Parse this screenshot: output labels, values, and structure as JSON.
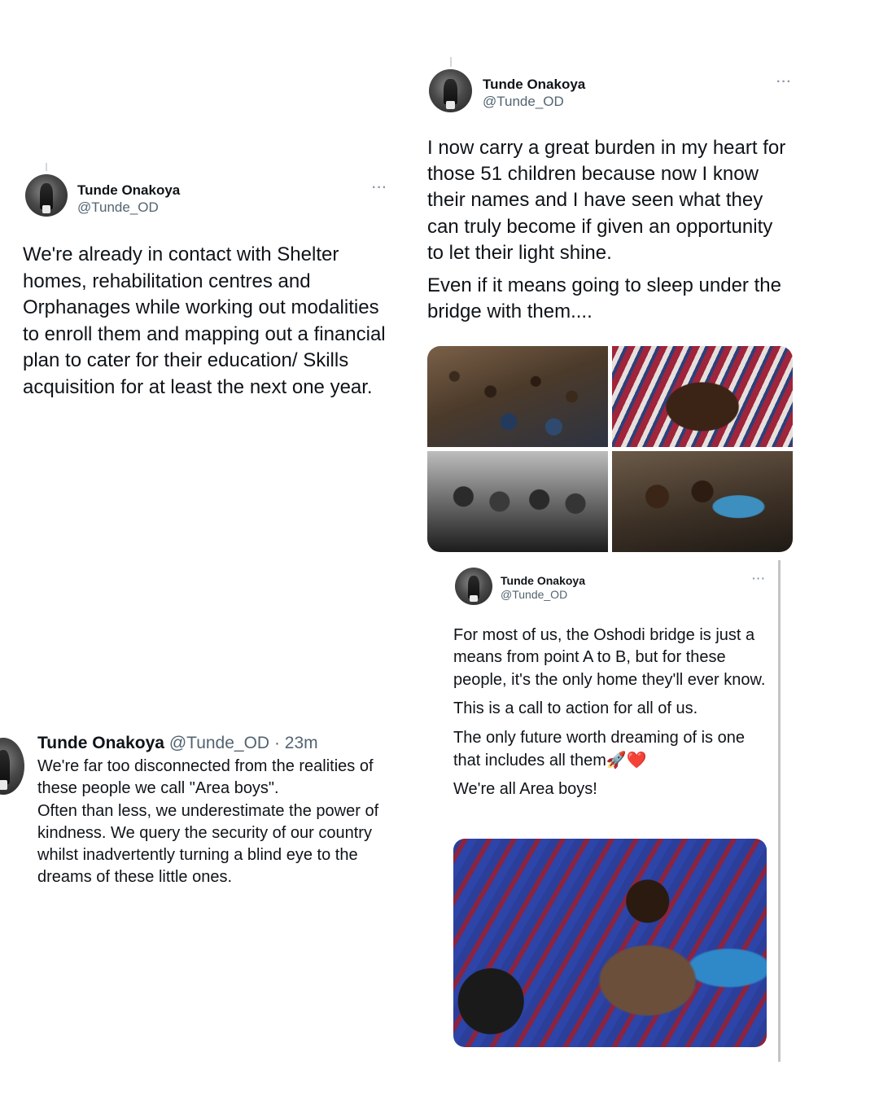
{
  "tweets": [
    {
      "name": "Tunde Onakoya",
      "handle": "@Tunde_OD",
      "more": "···",
      "paragraphs": [
        "We're already in contact with Shelter homes, rehabilitation centres and Orphanages while working out modalities to enroll them and mapping out a financial plan to cater for their education/ Skills acquisition for at least the next one year."
      ]
    },
    {
      "name": "Tunde Onakoya",
      "handle": "@Tunde_OD",
      "more": "···",
      "paragraphs": [
        "I now carry a great burden in my heart for those 51 children because now I know their names and I have seen what they can truly become if given an opportunity to let their light shine.",
        "Even if it means going to sleep under the bridge with them...."
      ]
    },
    {
      "name": "Tunde Onakoya",
      "handle": "@Tunde_OD",
      "more": "···",
      "paragraphs": [
        "For most of us, the Oshodi bridge is just a means from point A to B, but for these people,  it's the only home they'll ever know.",
        "This is a call to action for all of us.",
        "The only future worth dreaming of is one that includes all them",
        "We're all Area boys!"
      ],
      "emoji": "🚀❤️"
    },
    {
      "name": "Tunde Onakoya",
      "handle": "@Tunde_OD",
      "time": "· 23m",
      "paragraphs": [
        "We're far too disconnected from the realities of these people we call \"Area boys\".",
        "Often than less, we underestimate the power of kindness. We query the security of our country whilst inadvertently turning a blind eye to the dreams of these little ones."
      ]
    }
  ],
  "icons": {
    "more": "more-options-icon",
    "avatar": "profile-avatar"
  }
}
